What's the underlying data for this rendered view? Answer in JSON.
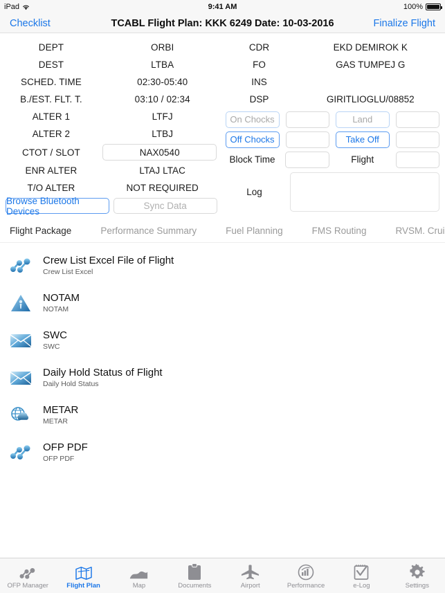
{
  "status_bar": {
    "device": "iPad",
    "wifi_icon": "wifi-icon",
    "time": "9:41 AM",
    "battery_percent": "100%",
    "battery_icon": "battery-full-icon"
  },
  "nav_bar": {
    "back_label": "Checklist",
    "title": "TCABL Flight Plan: KKK 6249 Date: 10-03-2016",
    "action_label": "Finalize Flight",
    "tint_color": "#1b77e8"
  },
  "flight_info_left": {
    "rows": [
      {
        "label": "DEPT",
        "value": "ORBI"
      },
      {
        "label": "DEST",
        "value": "LTBA"
      },
      {
        "label": "SCHED. TIME",
        "value": "02:30-05:40"
      },
      {
        "label": "B./EST. FLT. T.",
        "value": "03:10 / 02:34"
      },
      {
        "label": "ALTER 1",
        "value": "LTFJ"
      },
      {
        "label": "ALTER 2",
        "value": "LTBJ"
      }
    ],
    "ctot_label": "CTOT / SLOT",
    "ctot_value": "NAX0540",
    "enr_alter_label": "ENR ALTER",
    "enr_alter_value": "LTAJ  LTAC",
    "to_alter_label": "T/O ALTER",
    "to_alter_value": "NOT REQUIRED",
    "browse_bluetooth_label": "Browse Bluetooth Devices",
    "sync_data_label": "Sync Data"
  },
  "flight_info_right": {
    "rows": [
      {
        "label": "CDR",
        "value": "EKD DEMIROK K"
      },
      {
        "label": "FO",
        "value": "GAS TUMPEJ  G"
      },
      {
        "label": "INS",
        "value": ""
      },
      {
        "label": "DSP",
        "value": "GIRITLIOGLU/08852"
      }
    ],
    "on_chocks_label": "On Chocks",
    "on_chocks_value": "",
    "land_label": "Land",
    "land_value": "",
    "off_chocks_label": "Off Chocks",
    "off_chocks_value": "",
    "take_off_label": "Take Off",
    "take_off_value": "",
    "block_time_label": "Block Time",
    "block_time_value": "",
    "flight_label": "Flight",
    "flight_value": "",
    "log_label": "Log",
    "log_value": ""
  },
  "section_tabs": [
    {
      "label": "Flight Package",
      "active": true
    },
    {
      "label": "Performance Summary",
      "active": false
    },
    {
      "label": "Fuel Planning",
      "active": false
    },
    {
      "label": "FMS Routing",
      "active": false
    },
    {
      "label": "RVSM. Cruise",
      "active": false
    }
  ],
  "documents": [
    {
      "title": "Crew List Excel File of Flight",
      "subtitle": "Crew List Excel",
      "icon": "molecule-icon"
    },
    {
      "title": "NOTAM",
      "subtitle": "NOTAM",
      "icon": "warning-triangle-icon"
    },
    {
      "title": "SWC",
      "subtitle": "SWC",
      "icon": "envelope-icon"
    },
    {
      "title": "Daily Hold Status of Flight",
      "subtitle": "Daily Hold Status",
      "icon": "envelope-icon"
    },
    {
      "title": "METAR",
      "subtitle": "METAR",
      "icon": "globe-cloud-icon"
    },
    {
      "title": "OFP PDF",
      "subtitle": "OFP PDF",
      "icon": "molecule-icon"
    }
  ],
  "tab_bar": [
    {
      "label": "OFP Manager",
      "icon": "molecule-icon",
      "active": false
    },
    {
      "label": "Flight Plan",
      "icon": "map-folded-icon",
      "active": true
    },
    {
      "label": "Map",
      "icon": "map-terrain-icon",
      "active": false
    },
    {
      "label": "Documents",
      "icon": "clipboard-icon",
      "active": false
    },
    {
      "label": "Airport",
      "icon": "airplane-icon",
      "active": false
    },
    {
      "label": "Performance",
      "icon": "gauge-chart-icon",
      "active": false
    },
    {
      "label": "e-Log",
      "icon": "checklist-icon",
      "active": false
    },
    {
      "label": "Settings",
      "icon": "gear-icon",
      "active": false
    }
  ]
}
